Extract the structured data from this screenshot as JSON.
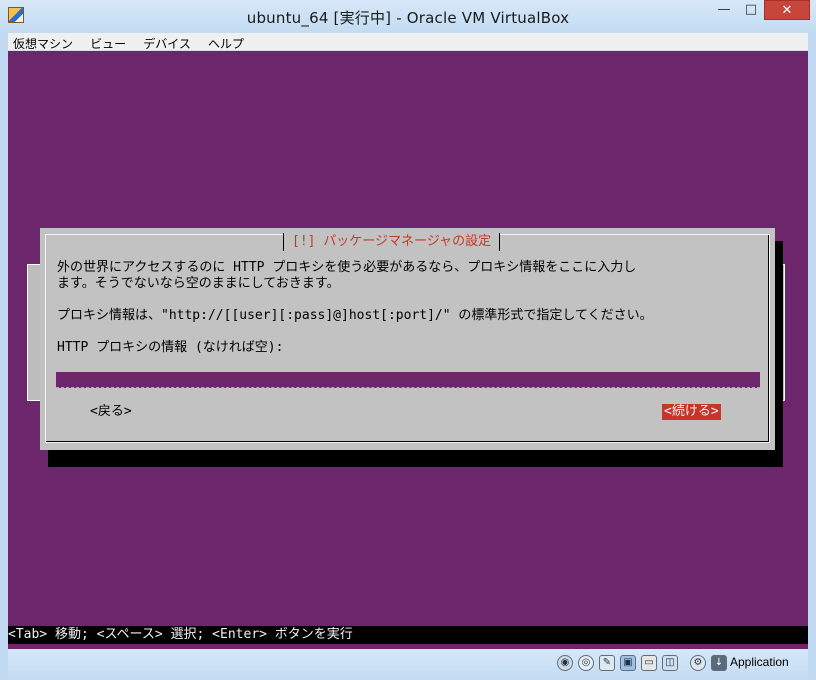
{
  "window": {
    "title": "ubuntu_64 [実行中] - Oracle VM VirtualBox",
    "minimize_icon": "minimize-icon",
    "maximize_icon": "maximize-icon",
    "close_icon": "close-icon"
  },
  "menubar": {
    "items": [
      "仮想マシン",
      "ビュー",
      "デバイス",
      "ヘルプ"
    ]
  },
  "dialog": {
    "title": "[!] パッケージマネージャの設定",
    "line1": "外の世界にアクセスするのに HTTP プロキシを使う必要があるなら、プロキシ情報をここに入力し",
    "line2": "ます。そうでないなら空のままにしておきます。",
    "line3": "プロキシ情報は、\"http://[[user][:pass]@]host[:port]/\" の標準形式で指定してください。",
    "field_label": "HTTP プロキシの情報 (なければ空):",
    "field_value": "",
    "back_button": "<戻る>",
    "continue_button": "<続ける>"
  },
  "console": {
    "help_line": "<Tab> 移動; <スペース> 選択; <Enter> ボタンを実行"
  },
  "statusbar": {
    "icons": [
      "hard-disk-icon",
      "optical-drive-icon",
      "usb-icon",
      "network-icon",
      "shared-folder-icon",
      "video-capture-icon",
      "mouse-integration-icon",
      "keyboard-capture-icon"
    ],
    "host_key_label": "Application"
  },
  "colors": {
    "console_background": "#6d266c",
    "dialog_background": "#c2c2c2",
    "dialog_title": "#c23a2a",
    "selected_button": "#c9342a"
  }
}
